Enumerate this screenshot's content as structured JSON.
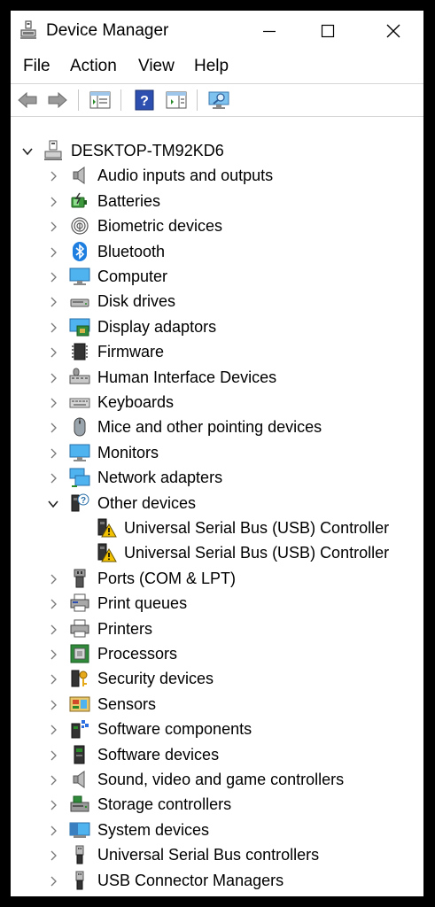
{
  "window": {
    "title": "Device Manager"
  },
  "menu": [
    "File",
    "Action",
    "View",
    "Help"
  ],
  "tree": {
    "root": {
      "label": "DESKTOP-TM92KD6"
    },
    "categories": [
      {
        "label": "Audio inputs and outputs",
        "icon": "speaker-icon"
      },
      {
        "label": "Batteries",
        "icon": "battery-icon"
      },
      {
        "label": "Biometric devices",
        "icon": "fingerprint-icon"
      },
      {
        "label": "Bluetooth",
        "icon": "bluetooth-icon"
      },
      {
        "label": "Computer",
        "icon": "computer-icon"
      },
      {
        "label": "Disk drives",
        "icon": "disk-drive-icon"
      },
      {
        "label": "Display adaptors",
        "icon": "display-adapter-icon"
      },
      {
        "label": "Firmware",
        "icon": "firmware-chip-icon"
      },
      {
        "label": "Human Interface Devices",
        "icon": "hid-icon"
      },
      {
        "label": "Keyboards",
        "icon": "keyboard-icon"
      },
      {
        "label": "Mice and other pointing devices",
        "icon": "mouse-icon"
      },
      {
        "label": "Monitors",
        "icon": "monitor-icon"
      },
      {
        "label": "Network adapters",
        "icon": "network-icon"
      },
      {
        "label": "Other devices",
        "icon": "unknown-device-icon"
      },
      {
        "label": "Ports (COM & LPT)",
        "icon": "port-icon"
      },
      {
        "label": "Print queues",
        "icon": "print-queue-icon"
      },
      {
        "label": "Printers",
        "icon": "printer-icon"
      },
      {
        "label": "Processors",
        "icon": "processor-icon"
      },
      {
        "label": "Security devices",
        "icon": "security-key-icon"
      },
      {
        "label": "Sensors",
        "icon": "sensor-icon"
      },
      {
        "label": "Software components",
        "icon": "software-component-icon"
      },
      {
        "label": "Software devices",
        "icon": "software-device-icon"
      },
      {
        "label": "Sound, video and game controllers",
        "icon": "speaker-icon"
      },
      {
        "label": "Storage controllers",
        "icon": "storage-controller-icon"
      },
      {
        "label": "System devices",
        "icon": "system-device-icon"
      },
      {
        "label": "Universal Serial Bus controllers",
        "icon": "usb-icon"
      },
      {
        "label": "USB Connector Managers",
        "icon": "usb-icon"
      }
    ],
    "other_devices_children": [
      {
        "label": "Universal Serial Bus (USB) Controller",
        "icon": "warning-device-icon"
      },
      {
        "label": "Universal Serial Bus (USB) Controller",
        "icon": "warning-device-icon"
      }
    ]
  }
}
